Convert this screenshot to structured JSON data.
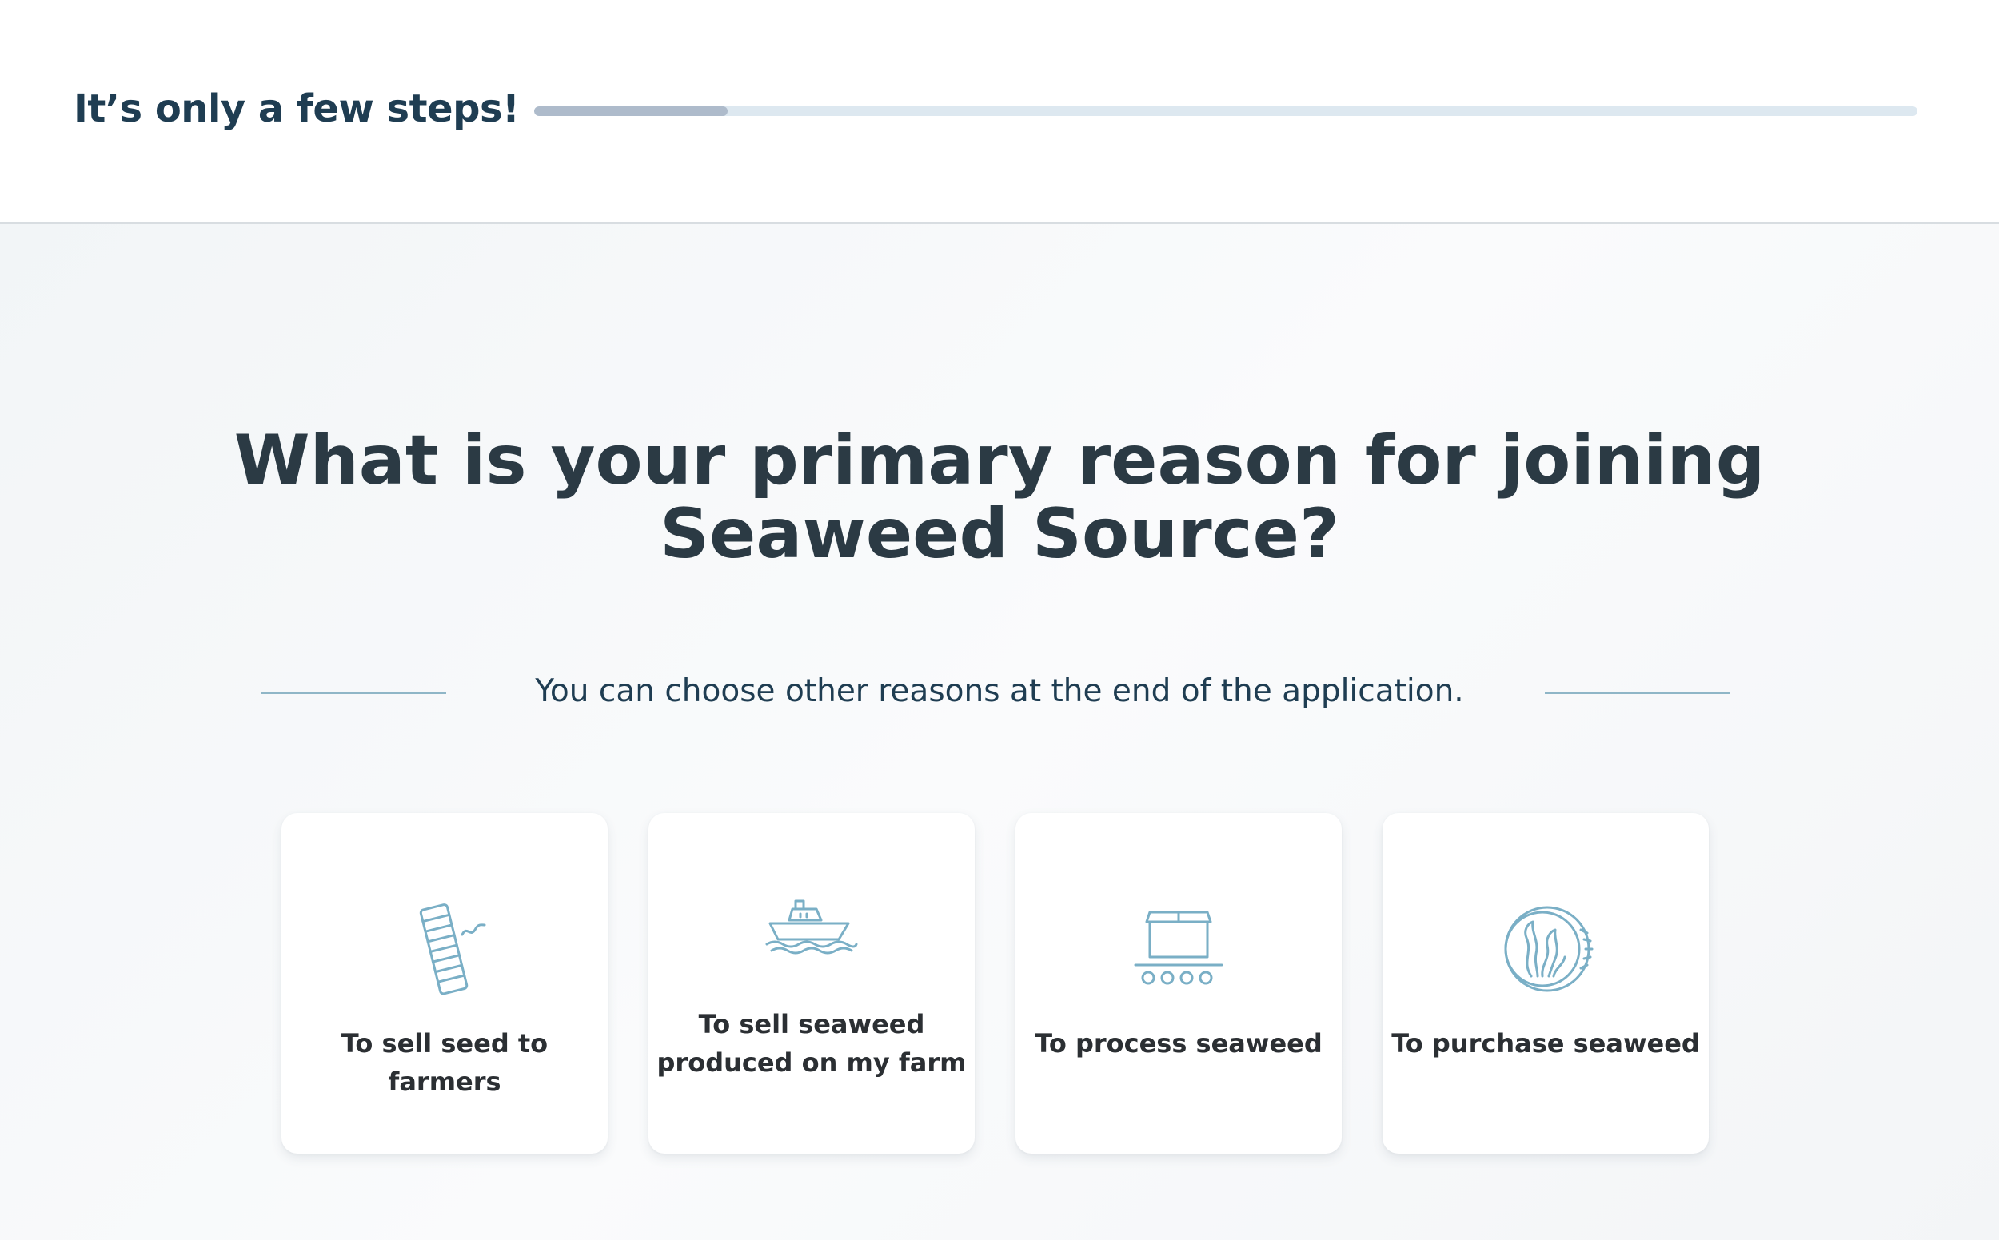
{
  "header": {
    "title": "It’s only a few steps!",
    "progress_fraction": 0.14
  },
  "main": {
    "question": "What is your primary reason for joining Seaweed Source?",
    "subtitle": "You can choose other reasons at the end of the application."
  },
  "options": [
    {
      "label": "To sell seed to farmers",
      "icon": "seed-line-icon"
    },
    {
      "label": "To sell seaweed produced on my farm",
      "icon": "boat-icon"
    },
    {
      "label": "To process seaweed",
      "icon": "conveyor-box-icon"
    },
    {
      "label": "To purchase seaweed",
      "icon": "seaweed-coin-icon"
    }
  ],
  "colors": {
    "heading": "#1f3d52",
    "icon": "#7aafc6",
    "progress_fill": "#aebbcb",
    "progress_track": "#dde8f0"
  }
}
